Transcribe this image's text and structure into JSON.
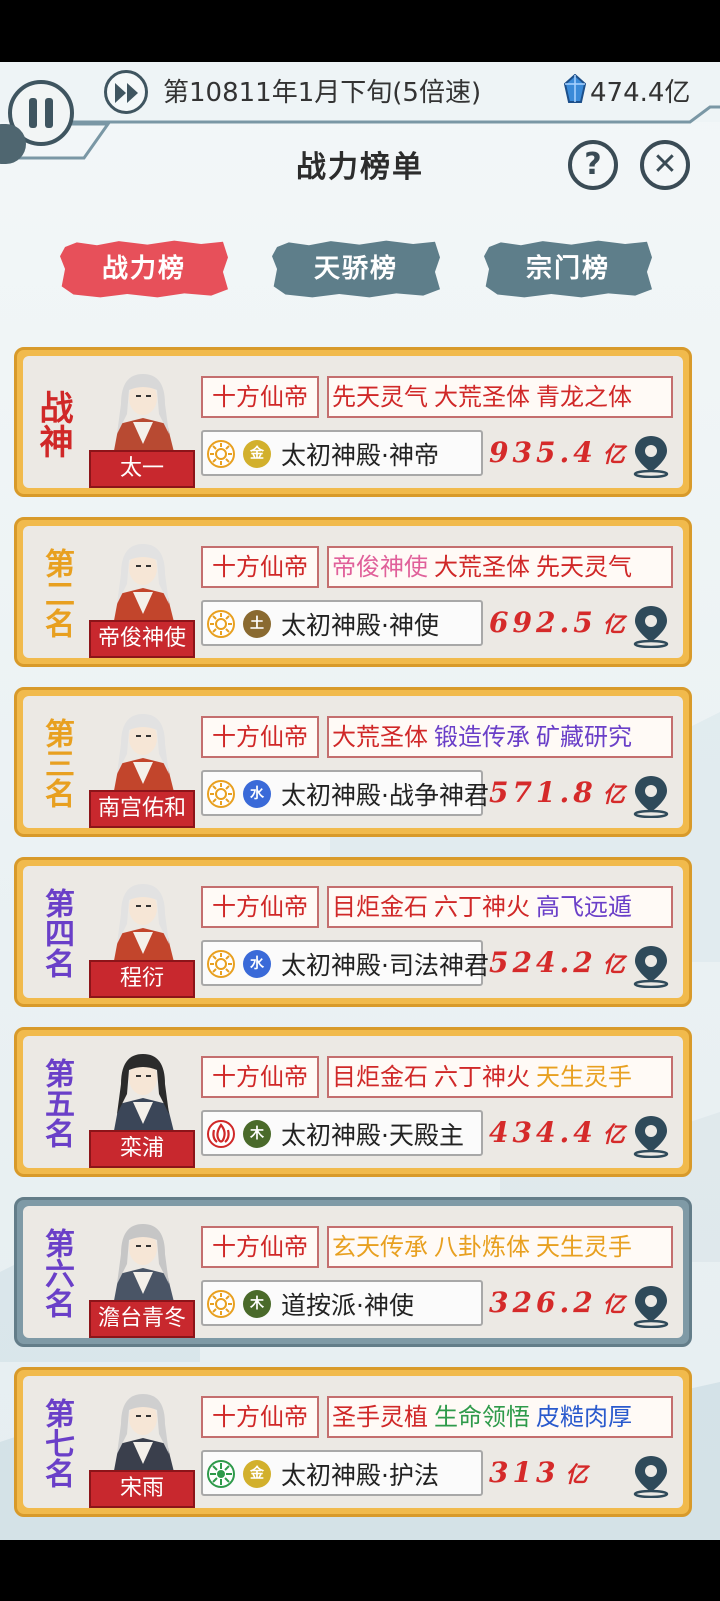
{
  "header": {
    "game_date": "第10811年1月下旬(5倍速)",
    "currency": "474.4亿",
    "title": "战力榜单",
    "help_label": "?",
    "close_label": "✕"
  },
  "icons": {
    "fast_forward": "fast-forward-icon",
    "pause": "pause-icon",
    "gem": "spirit-stone-icon",
    "location": "map-pin-icon"
  },
  "tabs": [
    {
      "label": "战力榜",
      "active": true
    },
    {
      "label": "天骄榜",
      "active": false
    },
    {
      "label": "宗门榜",
      "active": false
    }
  ],
  "colors": {
    "active_tab": "#e7505a",
    "inactive_tab": "#5e7e8a",
    "gold_frame": "#f1ba4c",
    "slate_frame": "#7f9aa6",
    "power_red": "#d52a2a",
    "trait_red": "#d02828",
    "trait_pink": "#e0609a",
    "trait_purple": "#6a3fc8",
    "trait_gold": "#e8a020",
    "trait_green": "#2e9a4a",
    "trait_blue": "#2a5acd"
  },
  "rankings": [
    {
      "rank_label": "战神",
      "rank_color": "#d02828",
      "frame": "gold",
      "name": "太一",
      "realm": "十方仙帝",
      "traits": [
        {
          "text": "先天灵气",
          "color": "#d02828"
        },
        {
          "text": "大荒圣体",
          "color": "#d02828"
        },
        {
          "text": "青龙之体",
          "color": "#d02828"
        }
      ],
      "element": "金",
      "element_color": "#d2b02c",
      "emblem": "sun",
      "sect": "太初神殿·神帝",
      "power": "935.4",
      "unit": "亿"
    },
    {
      "rank_label": "第二名",
      "rank_color": "#e8a020",
      "frame": "gold",
      "name": "帝俊神使",
      "realm": "十方仙帝",
      "traits": [
        {
          "text": "帝俊神使",
          "color": "#e0609a"
        },
        {
          "text": "大荒圣体",
          "color": "#d02828"
        },
        {
          "text": "先天灵气",
          "color": "#d02828"
        }
      ],
      "element": "土",
      "element_color": "#8a6a30",
      "emblem": "sun",
      "sect": "太初神殿·神使",
      "power": "692.5",
      "unit": "亿"
    },
    {
      "rank_label": "第三名",
      "rank_color": "#e8a020",
      "frame": "gold",
      "name": "南宫佑和",
      "realm": "十方仙帝",
      "traits": [
        {
          "text": "大荒圣体",
          "color": "#d02828"
        },
        {
          "text": "锻造传承",
          "color": "#6a3fc8"
        },
        {
          "text": "矿藏研究",
          "color": "#6a3fc8"
        }
      ],
      "element": "水",
      "element_color": "#3a6ad8",
      "emblem": "sun",
      "sect": "太初神殿·战争神君",
      "power": "571.8",
      "unit": "亿"
    },
    {
      "rank_label": "第四名",
      "rank_color": "#6a3fc8",
      "frame": "gold",
      "name": "程衍",
      "realm": "十方仙帝",
      "traits": [
        {
          "text": "目炬金石",
          "color": "#d02828"
        },
        {
          "text": "六丁神火",
          "color": "#d02828"
        },
        {
          "text": "高飞远遁",
          "color": "#6a3fc8"
        }
      ],
      "element": "水",
      "element_color": "#3a6ad8",
      "emblem": "sun",
      "sect": "太初神殿·司法神君",
      "power": "524.2",
      "unit": "亿"
    },
    {
      "rank_label": "第五名",
      "rank_color": "#6a3fc8",
      "frame": "gold",
      "name": "栾浦",
      "realm": "十方仙帝",
      "traits": [
        {
          "text": "目炬金石",
          "color": "#d02828"
        },
        {
          "text": "六丁神火",
          "color": "#d02828"
        },
        {
          "text": "天生灵手",
          "color": "#e8a020"
        }
      ],
      "element": "木",
      "element_color": "#4a6a2a",
      "emblem": "flame",
      "sect": "太初神殿·天殿主",
      "power": "434.4",
      "unit": "亿"
    },
    {
      "rank_label": "第六名",
      "rank_color": "#6a3fc8",
      "frame": "slate",
      "name": "澹台青冬",
      "realm": "十方仙帝",
      "traits": [
        {
          "text": "玄天传承",
          "color": "#e8a020"
        },
        {
          "text": "八卦炼体",
          "color": "#e8a020"
        },
        {
          "text": "天生灵手",
          "color": "#e8a020"
        }
      ],
      "element": "木",
      "element_color": "#4a6a2a",
      "emblem": "sun",
      "sect": "道按派·神使",
      "power": "326.2",
      "unit": "亿"
    },
    {
      "rank_label": "第七名",
      "rank_color": "#6a3fc8",
      "frame": "gold",
      "name": "宋雨",
      "realm": "十方仙帝",
      "traits": [
        {
          "text": "圣手灵植",
          "color": "#d02828"
        },
        {
          "text": "生命领悟",
          "color": "#2e9a4a"
        },
        {
          "text": "皮糙肉厚",
          "color": "#2a5acd"
        }
      ],
      "element": "金",
      "element_color": "#d2b02c",
      "emblem": "leaf",
      "sect": "太初神殿·护法",
      "power": "313",
      "unit": "亿"
    }
  ]
}
